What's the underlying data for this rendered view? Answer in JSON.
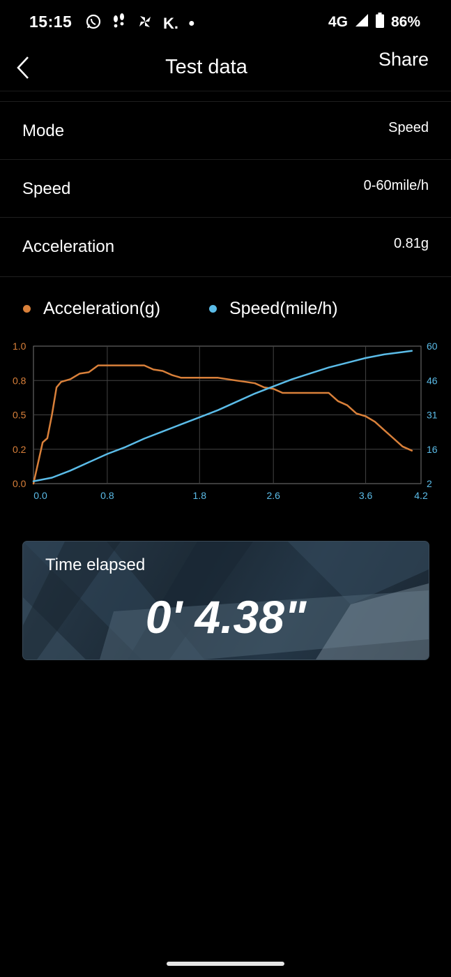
{
  "status_bar": {
    "time": "15:15",
    "network": "4G",
    "battery": "86%"
  },
  "header": {
    "title": "Test data",
    "share_label": "Share"
  },
  "rows": [
    {
      "label": "Mode",
      "value": "Speed"
    },
    {
      "label": "Speed",
      "value": "0-60mile/h"
    },
    {
      "label": "Acceleration",
      "value": "0.81g"
    }
  ],
  "legend": {
    "acceleration_label": "Acceleration(g)",
    "speed_label": "Speed(mile/h)"
  },
  "colors": {
    "acceleration": "#d9803a",
    "speed": "#5bbce8",
    "grid": "#444444"
  },
  "chart_data": {
    "type": "line",
    "grid": true,
    "x_ticks": [
      "0.0",
      "0.8",
      "1.8",
      "2.6",
      "3.6",
      "4.2"
    ],
    "x_tick_values": [
      0.0,
      0.8,
      1.8,
      2.6,
      3.6,
      4.2
    ],
    "xlim": [
      0.0,
      4.2
    ],
    "y_left_ticks": [
      "0.0",
      "0.2",
      "0.5",
      "0.8",
      "1.0"
    ],
    "y_left_lim": [
      0.0,
      1.0
    ],
    "y_right_ticks": [
      "2",
      "16",
      "31",
      "46",
      "60"
    ],
    "y_right_lim": [
      2,
      60
    ],
    "series": [
      {
        "name": "Acceleration(g)",
        "axis": "left",
        "x": [
          0.0,
          0.1,
          0.15,
          0.2,
          0.25,
          0.3,
          0.4,
          0.5,
          0.6,
          0.7,
          0.8,
          0.9,
          1.0,
          1.1,
          1.2,
          1.3,
          1.4,
          1.5,
          1.6,
          1.8,
          2.0,
          2.1,
          2.2,
          2.3,
          2.4,
          2.5,
          2.6,
          2.7,
          2.8,
          3.0,
          3.2,
          3.3,
          3.4,
          3.5,
          3.6,
          3.7,
          3.8,
          3.9,
          4.0,
          4.1
        ],
        "y": [
          0.0,
          0.3,
          0.33,
          0.5,
          0.7,
          0.74,
          0.76,
          0.8,
          0.81,
          0.86,
          0.86,
          0.86,
          0.86,
          0.86,
          0.86,
          0.83,
          0.82,
          0.79,
          0.77,
          0.77,
          0.77,
          0.76,
          0.75,
          0.74,
          0.73,
          0.7,
          0.69,
          0.66,
          0.66,
          0.66,
          0.66,
          0.6,
          0.57,
          0.51,
          0.49,
          0.45,
          0.39,
          0.33,
          0.27,
          0.24
        ]
      },
      {
        "name": "Speed(mile/h)",
        "axis": "right",
        "x": [
          0.0,
          0.2,
          0.4,
          0.6,
          0.8,
          1.0,
          1.2,
          1.4,
          1.6,
          1.8,
          2.0,
          2.2,
          2.4,
          2.6,
          2.8,
          3.0,
          3.2,
          3.4,
          3.6,
          3.8,
          4.0,
          4.1
        ],
        "y": [
          3,
          4.5,
          7.5,
          11,
          14.5,
          17.5,
          21,
          24,
          27,
          30,
          33,
          36.5,
          40,
          43,
          46,
          48.5,
          51,
          53,
          55,
          56.5,
          57.5,
          58
        ]
      }
    ]
  },
  "timer": {
    "label": "Time elapsed",
    "value": "0' 4.38\""
  }
}
